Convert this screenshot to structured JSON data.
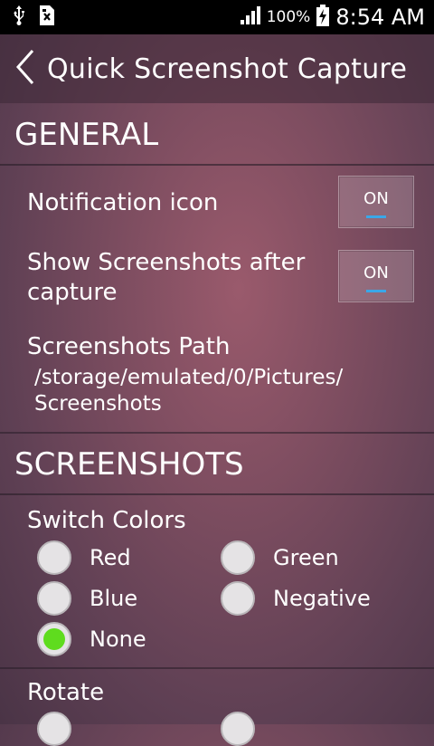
{
  "status_bar": {
    "battery": "100%",
    "time": "8:54 AM",
    "icons": [
      "usb-icon",
      "sim-icon",
      "signal-icon",
      "battery-charging-icon"
    ]
  },
  "action_bar": {
    "title": "Quick Screenshot Capture",
    "back_icon": "chevron-left-icon"
  },
  "general": {
    "header": "GENERAL",
    "notification_icon": {
      "label": "Notification icon",
      "toggle": "ON"
    },
    "show_after_capture": {
      "label_line1": "Show Screenshots after",
      "label_line2": "capture",
      "toggle": "ON"
    },
    "path": {
      "label": "Screenshots Path",
      "value_line1": "/storage/emulated/0/Pictures/",
      "value_line2": "Screenshots"
    }
  },
  "screenshots": {
    "header": "SCREENSHOTS",
    "switch_colors": {
      "label": "Switch Colors",
      "options": [
        "Red",
        "Green",
        "Blue",
        "Negative",
        "None"
      ],
      "selected": "None"
    },
    "rotate": {
      "label": "Rotate"
    }
  },
  "colors": {
    "radio_selected": "#5fdc1e",
    "toggle_indicator": "#3aa7e8"
  }
}
